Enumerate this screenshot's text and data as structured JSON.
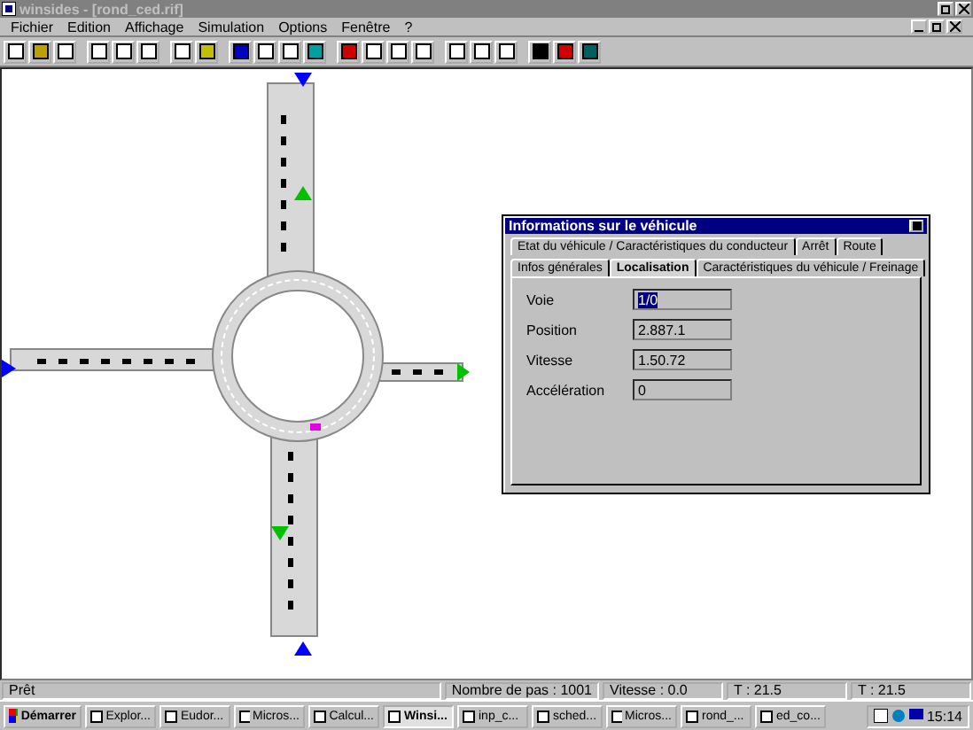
{
  "window": {
    "title": "winsides - [rond_ced.rif]"
  },
  "menu": [
    "Fichier",
    "Edition",
    "Affichage",
    "Simulation",
    "Options",
    "Fenêtre",
    "?"
  ],
  "dialog": {
    "title": "Informations sur le véhicule",
    "tabs_back": [
      {
        "label": "Etat du véhicule / Caractéristiques du conducteur",
        "selected": false
      },
      {
        "label": "Arrêt",
        "selected": false
      },
      {
        "label": "Route",
        "selected": false
      }
    ],
    "tabs_front": [
      {
        "label": "Infos générales",
        "selected": false
      },
      {
        "label": "Localisation",
        "selected": true
      },
      {
        "label": "Caractéristiques du véhicule / Freinage",
        "selected": false
      }
    ],
    "fields": [
      {
        "label": "Voie",
        "value": "1/0",
        "selected": true
      },
      {
        "label": "Position",
        "value": "2.887.1",
        "selected": false
      },
      {
        "label": "Vitesse",
        "value": "1.50.72",
        "selected": false
      },
      {
        "label": "Accélération",
        "value": "0",
        "selected": false
      }
    ]
  },
  "status_bar": [
    "Prêt",
    "Nombre de pas : 1001",
    "Vitesse : 0.0",
    "T : 21.5",
    "T : 21.5"
  ],
  "taskbar": {
    "start": "Démarrer",
    "tasks": [
      {
        "label": "Explor...",
        "selected": false
      },
      {
        "label": "Eudor...",
        "selected": false
      },
      {
        "label": "Micros...",
        "selected": false
      },
      {
        "label": "Calcul...",
        "selected": false
      },
      {
        "label": "Winsi...",
        "selected": true
      },
      {
        "label": "inp_c...",
        "selected": false
      },
      {
        "label": "sched...",
        "selected": false
      },
      {
        "label": "Micros...",
        "selected": false
      },
      {
        "label": "rond_...",
        "selected": false
      },
      {
        "label": "ed_co...",
        "selected": false
      }
    ],
    "clock": "15:14"
  }
}
